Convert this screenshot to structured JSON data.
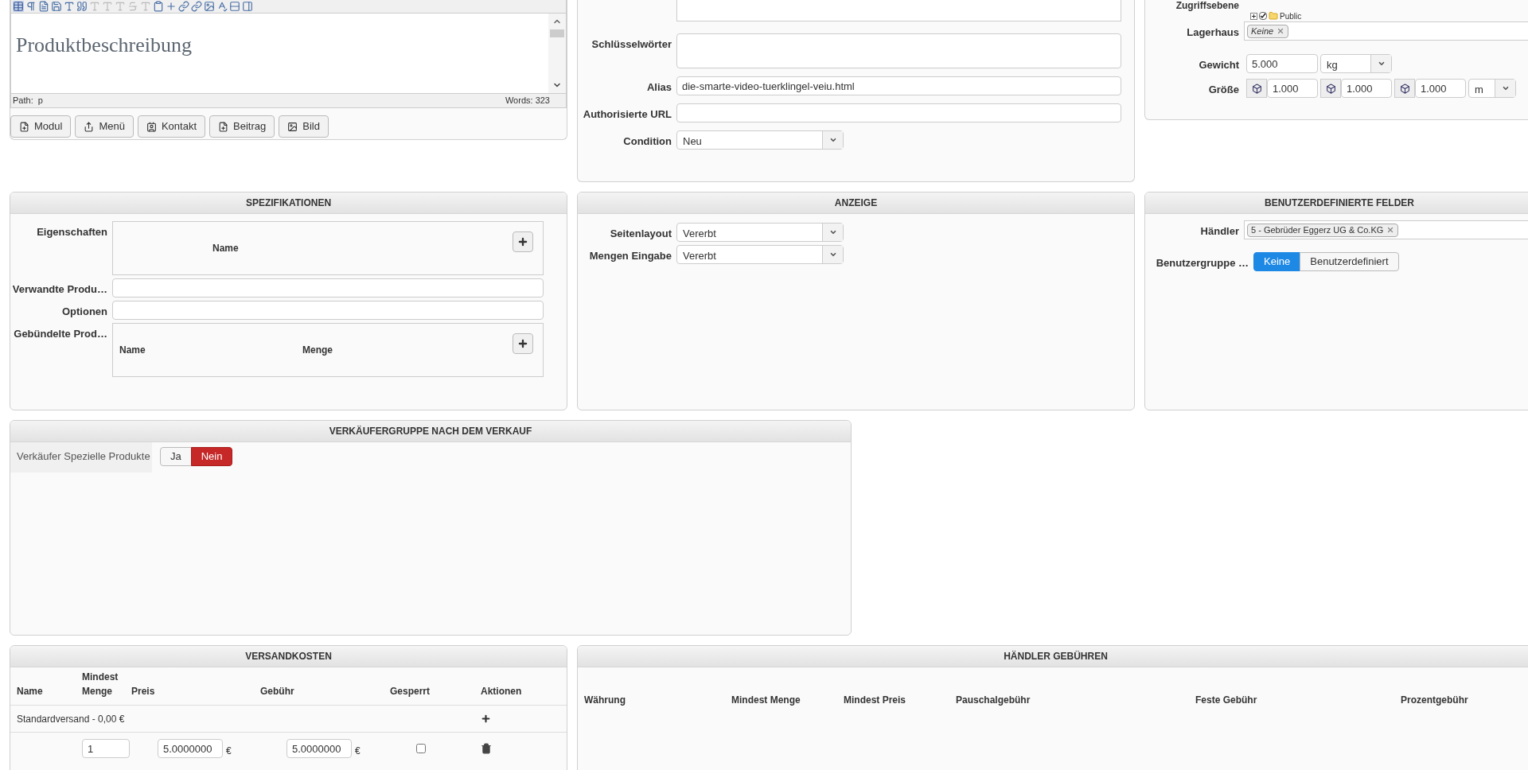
{
  "editor": {
    "content": "Produktbeschreibung",
    "path_label": "Path:",
    "path_value": "p",
    "words": "Words: 323",
    "buttons": [
      "Modul",
      "Menü",
      "Kontakt",
      "Beitrag",
      "Bild"
    ]
  },
  "details": {
    "fields": [
      {
        "kind": "textarea",
        "label": "Schlüsselwörter"
      },
      {
        "kind": "text",
        "label": "Alias",
        "value": "die-smarte-video-tuerklingel-veiu.html"
      },
      {
        "kind": "text",
        "label": "Authorisierte URL"
      },
      {
        "kind": "select",
        "label": "Condition",
        "value": "Neu"
      }
    ]
  },
  "access": {
    "label": "Zugriffsebene",
    "tree": [
      {
        "label": "Public",
        "checked": true,
        "expanded": false
      }
    ],
    "lagerhaus": {
      "label": "Lagerhaus",
      "tags": [
        "Keine"
      ]
    },
    "gewicht": {
      "label": "Gewicht",
      "value": "5.000",
      "unit": "kg"
    },
    "groesse": {
      "label": "Größe",
      "values": [
        "1.000",
        "1.000",
        "1.000"
      ],
      "unit": "m"
    }
  },
  "specs": {
    "title": "SPEZIFIKATIONEN",
    "rows": [
      {
        "kind": "table",
        "label": "Eigenschaften",
        "columns": [
          "Name"
        ]
      },
      {
        "kind": "input",
        "label": "Verwandte Produ…"
      },
      {
        "kind": "input",
        "label": "Optionen"
      },
      {
        "kind": "table",
        "label": "Gebündelte Prod…",
        "columns": [
          "Name",
          "Menge"
        ]
      }
    ]
  },
  "display": {
    "title": "ANZEIGE",
    "fields": [
      {
        "label": "Seitenlayout",
        "value": "Vererbt"
      },
      {
        "label": "Mengen Eingabe",
        "value": "Vererbt"
      }
    ]
  },
  "custom": {
    "title": "BENUTZERDEFINIERTE FELDER",
    "haendler": {
      "label": "Händler",
      "tags": [
        "5 - Gebrüder Eggerz UG & Co.KG"
      ]
    },
    "group": {
      "label": "Benutzergruppe …",
      "options": [
        {
          "label": "Keine",
          "selected": true
        },
        {
          "label": "Benutzerdefiniert",
          "selected": false
        }
      ]
    }
  },
  "seller_group": {
    "title": "VERKÄUFERGRUPPE NACH DEM VERKAUF",
    "label": "Verkäufer Spezielle Produkte",
    "options": [
      {
        "label": "Ja",
        "selected": false
      },
      {
        "label": "Nein",
        "selected": true
      }
    ]
  },
  "shipping": {
    "title": "VERSANDKOSTEN",
    "columns": [
      "Name",
      "Mindest Menge",
      "Preis",
      "Gebühr",
      "Gesperrt",
      "Aktionen"
    ],
    "rows": [
      {
        "kind": "group",
        "name": "Standardversand - 0,00 €"
      },
      {
        "kind": "entry",
        "min_qty": "1",
        "price": "5.0000000",
        "price_currency": "€",
        "fee": "5.0000000",
        "fee_currency": "€",
        "locked": false
      }
    ]
  },
  "vendor_fees": {
    "title": "HÄNDLER GEBÜHREN",
    "columns": [
      "Währung",
      "Mindest Menge",
      "Mindest Preis",
      "Pauschalgebühr",
      "Feste Gebühr",
      "Prozentgebühr"
    ]
  }
}
